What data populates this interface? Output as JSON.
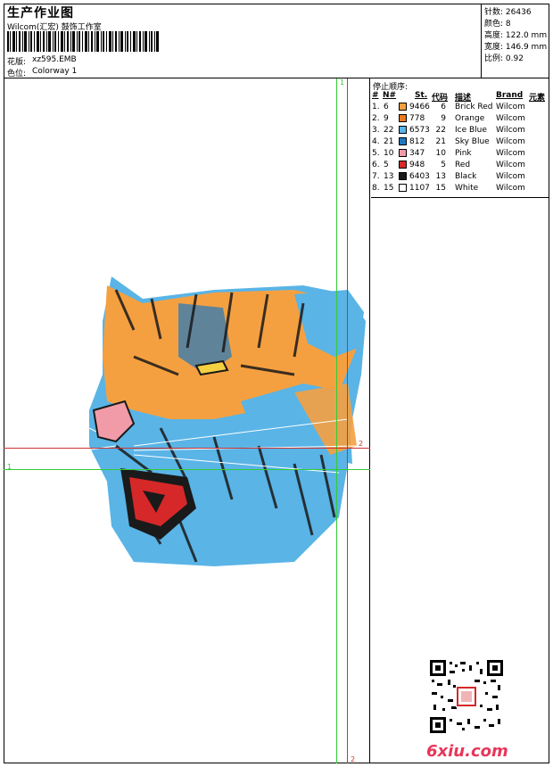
{
  "header": {
    "title": "生产作业图",
    "studio": "Wilcom(汇宏) 鼓饰工作室",
    "design_label": "花版:",
    "design_value": "xz595.EMB",
    "colorway_label": "色位:",
    "colorway_value": "Colorway 1"
  },
  "specs": [
    {
      "label": "针数:",
      "value": "26436"
    },
    {
      "label": "颜色:",
      "value": "8"
    },
    {
      "label": "高度:",
      "value": "122.0 mm"
    },
    {
      "label": "宽度:",
      "value": "146.9 mm"
    },
    {
      "label": "比例:",
      "value": "0.92"
    }
  ],
  "stop_sequence": {
    "title": "停止顺序:",
    "headers": {
      "num": "#",
      "needle": "N#",
      "stitches": "St.",
      "code": "代码",
      "desc": "描述",
      "brand": "Brand",
      "element": "元素"
    },
    "rows": [
      {
        "num": "1.",
        "needle": "6",
        "color": "#f5a040",
        "stitches": "9466",
        "code": "6",
        "desc": "Brick Red",
        "brand": "Wilcom"
      },
      {
        "num": "2.",
        "needle": "9",
        "color": "#ec7a1e",
        "stitches": "778",
        "code": "9",
        "desc": "Orange",
        "brand": "Wilcom"
      },
      {
        "num": "3.",
        "needle": "22",
        "color": "#5ab4e6",
        "stitches": "6573",
        "code": "22",
        "desc": "Ice Blue",
        "brand": "Wilcom"
      },
      {
        "num": "4.",
        "needle": "21",
        "color": "#1f78c0",
        "stitches": "812",
        "code": "21",
        "desc": "Sky Blue",
        "brand": "Wilcom"
      },
      {
        "num": "5.",
        "needle": "10",
        "color": "#f29ba8",
        "stitches": "347",
        "code": "10",
        "desc": "Pink",
        "brand": "Wilcom"
      },
      {
        "num": "6.",
        "needle": "5",
        "color": "#d62828",
        "stitches": "948",
        "code": "5",
        "desc": "Red",
        "brand": "Wilcom"
      },
      {
        "num": "7.",
        "needle": "13",
        "color": "#1a1a1a",
        "stitches": "6403",
        "code": "13",
        "desc": "Black",
        "brand": "Wilcom"
      },
      {
        "num": "8.",
        "needle": "15",
        "color": "#ffffff",
        "stitches": "1107",
        "code": "15",
        "desc": "White",
        "brand": "Wilcom"
      }
    ]
  },
  "guides": {
    "vertical_top": "1",
    "vertical_bottom": "2",
    "horizontal_left": "1",
    "horizontal_right": "2"
  },
  "watermark": "6xiu.com",
  "colors": {
    "guide_green": "#33cc33",
    "guide_red": "#cc3333",
    "orange": "#f5a040",
    "ice_blue": "#5ab4e6",
    "sky_blue": "#1f78c0",
    "black": "#1a1a1a",
    "pink": "#f29ba8",
    "red": "#d62828"
  }
}
